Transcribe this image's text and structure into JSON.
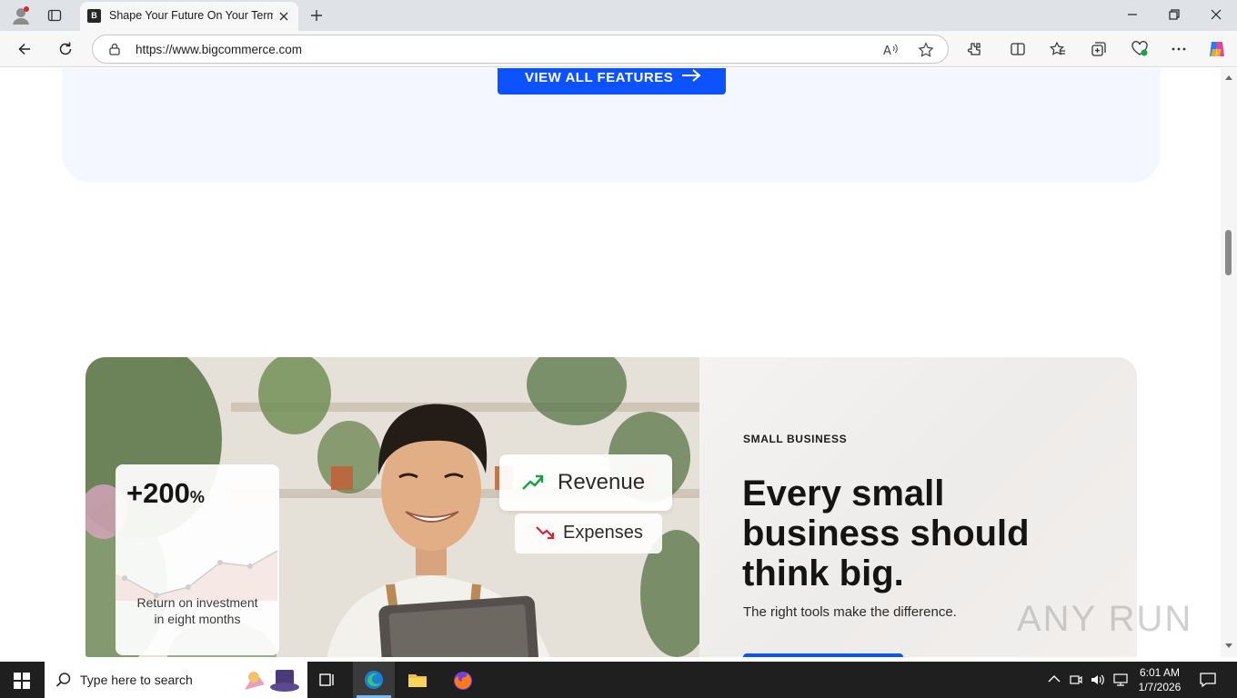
{
  "browser": {
    "tab": {
      "title": "Shape Your Future On Your Terms",
      "favicon_letter": "B"
    },
    "address_bar": {
      "url": "https://www.bigcommerce.com"
    },
    "icons": [
      "profile-icon",
      "tab-actions-icon",
      "close-tab-icon",
      "new-tab-icon",
      "back-icon",
      "refresh-icon",
      "site-info-icon",
      "read-aloud-icon",
      "favorite-icon",
      "extensions-icon",
      "split-screen-icon",
      "favorites-icon",
      "collections-icon",
      "browser-essentials-icon",
      "more-icon",
      "copilot-icon",
      "minimize-icon",
      "restore-icon",
      "close-window-icon"
    ]
  },
  "page": {
    "features_button": {
      "label": "VIEW ALL FEATURES"
    },
    "small_business": {
      "eyebrow": "SMALL BUSINESS",
      "headline": "Every small business should think big.",
      "subline": "The right tools make the difference."
    },
    "overlays": {
      "roi_value": "+200",
      "roi_unit": "%",
      "roi_caption_line1": "Return on investment",
      "roi_caption_line2": "in eight months",
      "revenue_label": "Revenue",
      "expenses_label": "Expenses"
    },
    "watermark": "ANY RUN"
  },
  "taskbar": {
    "search_placeholder": "Type here to search",
    "time": "6:01 AM",
    "date": "1/7/2026"
  },
  "colors": {
    "accent_blue": "#0d52ff",
    "panel_bg": "#f4f7ff",
    "revenue_green": "#1e9e4a",
    "expenses_red": "#d4253a"
  }
}
